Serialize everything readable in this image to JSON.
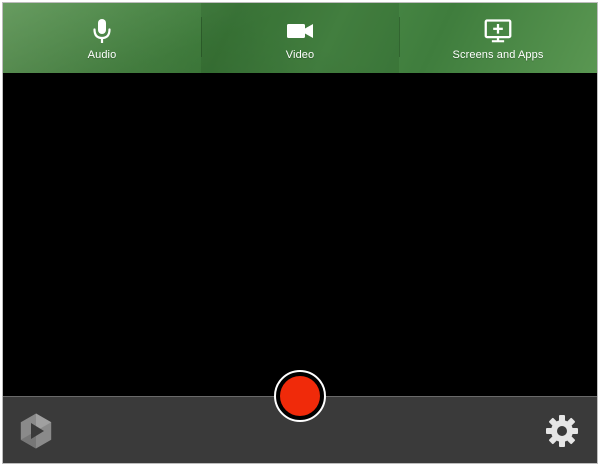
{
  "modes": [
    {
      "id": "audio",
      "label": "Audio",
      "icon": "microphone-icon"
    },
    {
      "id": "video",
      "label": "Video",
      "icon": "video-camera-icon"
    },
    {
      "id": "screens",
      "label": "Screens and Apps",
      "icon": "screen-add-icon"
    }
  ],
  "colors": {
    "mode_bar": "#4a8745",
    "preview": "#000000",
    "bottom_bar": "#3a3a3a",
    "record": "#f02a0a",
    "logo": "#8a8a8a",
    "settings": "#e6e6e6"
  },
  "bottom_bar": {
    "logo_icon": "app-logo-icon",
    "settings_icon": "gear-icon",
    "record_icon": "record-icon"
  }
}
